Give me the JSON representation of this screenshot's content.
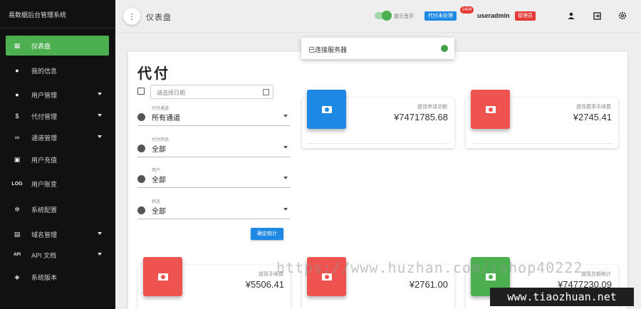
{
  "app": {
    "brand": "易数据后台管理系统"
  },
  "sidebar": {
    "items": [
      {
        "label": "仪表盘",
        "icon": "dashboard-icon",
        "glyph": "▦",
        "active": true,
        "has_caret": false
      },
      {
        "label": "我的信息",
        "icon": "person-icon",
        "glyph": "●",
        "active": false,
        "has_caret": false
      },
      {
        "label": "用户管理",
        "icon": "person-icon",
        "glyph": "●",
        "active": false,
        "has_caret": true
      },
      {
        "label": "代付管理",
        "icon": "dollar-icon",
        "glyph": "$",
        "active": false,
        "has_caret": true
      },
      {
        "label": "通道管理",
        "icon": "infinity-icon",
        "glyph": "∞",
        "active": false,
        "has_caret": true
      },
      {
        "label": "用户充值",
        "icon": "money-icon",
        "glyph": "▣",
        "active": false,
        "has_caret": false
      },
      {
        "label": "用户账变",
        "icon": "log-icon",
        "glyph": "LOG",
        "active": false,
        "has_caret": false
      },
      {
        "label": "系统配置",
        "icon": "settings-icon",
        "glyph": "✲",
        "active": false,
        "has_caret": false
      },
      {
        "label": "域名管理",
        "icon": "domain-icon",
        "glyph": "▤",
        "active": false,
        "has_caret": true
      },
      {
        "label": "API 文档",
        "icon": "api-icon",
        "glyph": "API",
        "active": false,
        "has_caret": true
      },
      {
        "label": "系统版本",
        "icon": "version-icon",
        "glyph": "◈",
        "active": false,
        "has_caret": false
      }
    ]
  },
  "header": {
    "title": "仪表盘",
    "toggle_label": "提示音开",
    "pending_label": "代付未处理",
    "pending_count": "2404",
    "username": "useradmin",
    "role": "管理员"
  },
  "toast": {
    "message": "已连接服务器"
  },
  "panel": {
    "title": "代付",
    "date_placeholder": "请选择日期",
    "fields": [
      {
        "label": "代付通道",
        "value": "所有通道"
      },
      {
        "label": "代付状态",
        "value": "全部"
      },
      {
        "label": "用户",
        "value": "全部"
      },
      {
        "label": "状态",
        "value": "全部"
      }
    ],
    "submit_label": "确定统计"
  },
  "cards": [
    {
      "label": "提现申请总额",
      "value": "¥7471785.68",
      "color": "#1e88e5"
    },
    {
      "label": "提现费率手续费",
      "value": "¥2745.41",
      "color": "#ef5350"
    },
    {
      "label": "提现手续费",
      "value": "¥5506.41",
      "color": "#ef5350"
    },
    {
      "label": "",
      "value": "¥2761.00",
      "color": "#ef5350"
    },
    {
      "label": "提现总额统计",
      "value": "¥7477230.09",
      "color": "#4caf50"
    }
  ],
  "watermarks": {
    "left": "https://www.huzhan.com/ishop40222",
    "right": "www.tiaozhuan.net"
  }
}
